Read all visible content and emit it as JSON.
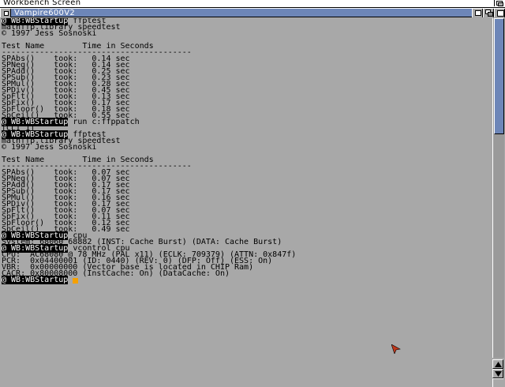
{
  "screen": {
    "title": "Workbench Screen"
  },
  "window": {
    "title": "Vampire600V2"
  },
  "prompt": "@ WB:WBStartup",
  "lines": [
    {
      "prompt": true,
      "cmd": " ffptest"
    },
    {
      "text": "mathffp.library speedtest"
    },
    {
      "text": "© 1997 Jess Sosnoski"
    },
    {
      "text": ""
    },
    {
      "text": "Test Name        Time in Seconds"
    },
    {
      "text": "----------------------------------------",
      "rule": true
    },
    {
      "text": "SPAbs()    took:   0.14 sec"
    },
    {
      "text": "SPNeg()    took:   0.14 sec"
    },
    {
      "text": "SPAdd()    took:   0.25 sec"
    },
    {
      "text": "SPSub()    took:   0.23 sec"
    },
    {
      "text": "SPMul()    took:   0.28 sec"
    },
    {
      "text": "SPDiv()    took:   0.45 sec"
    },
    {
      "text": "SpFlt()    took:   0.13 sec"
    },
    {
      "text": "SpFix()    took:   0.17 sec"
    },
    {
      "text": "SpFloor()  took:   0.18 sec"
    },
    {
      "text": "SpCeil()   took:   0.55 sec"
    },
    {
      "prompt": true,
      "cmd": " run c:ffppatch"
    },
    {
      "text": "[CLI 1]"
    },
    {
      "prompt": true,
      "cmd": " ffptest"
    },
    {
      "text": "mathffp.library speedtest"
    },
    {
      "text": "© 1997 Jess Sosnoski"
    },
    {
      "text": ""
    },
    {
      "text": "Test Name        Time in Seconds"
    },
    {
      "text": "----------------------------------------",
      "rule": true
    },
    {
      "text": "SPAbs()    took:   0.07 sec"
    },
    {
      "text": "SPNeg()    took:   0.07 sec"
    },
    {
      "text": "SPAdd()    took:   0.17 sec"
    },
    {
      "text": "SPSub()    took:   0.17 sec"
    },
    {
      "text": "SPMul()    took:   0.16 sec"
    },
    {
      "text": "SPDiv()    took:   0.17 sec"
    },
    {
      "text": "SpFlt()    took:   0.07 sec"
    },
    {
      "text": "SpFix()    took:   0.11 sec"
    },
    {
      "text": "SpFloor()  took:   0.12 sec"
    },
    {
      "text": "SpCeil()   took:   0.49 sec"
    },
    {
      "prompt": true,
      "cmd": " cpu"
    },
    {
      "text": "System: 68060 68882 (INST: Cache Burst) (DATA: Cache Burst)"
    },
    {
      "prompt": true,
      "cmd": " vcontrol cpu"
    },
    {
      "text": "CPU:  AC68080 @ 78 MHz (PAL x11) (ECLK: 709379) (ATTN: 0x847f)"
    },
    {
      "text": "PCR:  0x04400001 (ID: 0440) (REV: 0) (DFP: Off) (ESS: On)"
    },
    {
      "text": "VBR:  0x00000000 (Vector base is located in CHIP Ram)"
    },
    {
      "text": "CACR: 0x80008000 (InstCache: On) (DataCache: On)"
    },
    {
      "prompt": true,
      "cmd": "",
      "cursor": true
    }
  ],
  "colors": {
    "background": "#a8a8a8",
    "titlebar": "#6d86b8",
    "cursor": "#f5a000",
    "pointer": "#c0381c"
  },
  "icons": {
    "close": "close-icon",
    "zoom": "zoom-icon",
    "depth": "depth-icon",
    "iconify": "iconify-icon",
    "scroll_up": "arrow-up-icon",
    "scroll_down": "arrow-down-icon",
    "pointer": "mouse-pointer-icon"
  }
}
